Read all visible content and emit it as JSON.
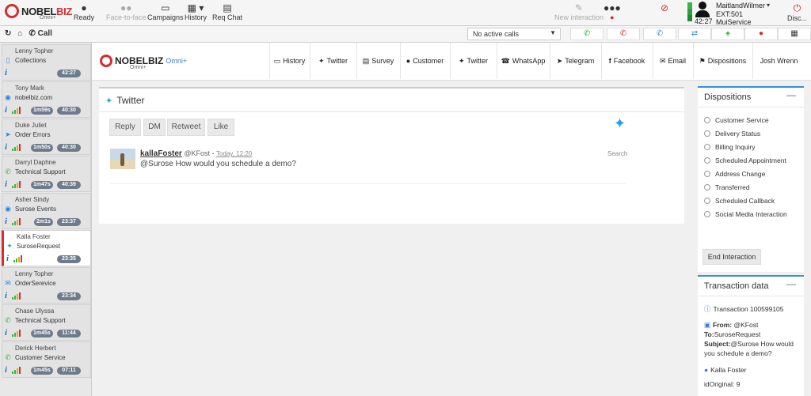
{
  "topbar": {
    "brand_main": "NOBEL",
    "brand_accent": "BIZ",
    "brand_sub": "Omni+",
    "buttons": [
      {
        "label": "Ready",
        "icon": "person-icon"
      },
      {
        "label": "Face-to-face",
        "icon": "people-icon"
      },
      {
        "label": "Campaigns",
        "icon": "folder-icon"
      },
      {
        "label": "History",
        "icon": "calendar-icon"
      },
      {
        "label": "Req Chat",
        "icon": "chat-icon"
      },
      {
        "label": "New interaction",
        "icon": "edit-icon"
      }
    ],
    "user": {
      "name": "MaitlandWilmer",
      "ext": "EXT:501",
      "service": "MuiService",
      "time": "42:27"
    },
    "disconnect_label": "Disc..."
  },
  "callbar": {
    "call_label": "Call",
    "active_calls": "No active calls"
  },
  "sidebar": {
    "conversations": [
      {
        "name": "Lenny Topher",
        "subject": "Collections",
        "channel": "phone",
        "t1": "",
        "t2": "42:27"
      },
      {
        "name": "Tony Mark",
        "subject": "nobelbiz.com",
        "channel": "chat",
        "t1": "1m59s",
        "t2": "40:30"
      },
      {
        "name": "Duke Juliet",
        "subject": "Order Errors",
        "channel": "telegram",
        "t1": "1m50s",
        "t2": "40:30"
      },
      {
        "name": "Darryl Daphne",
        "subject": "Technical Support",
        "channel": "whatsapp",
        "t1": "1m47s",
        "t2": "40:39"
      },
      {
        "name": "Asher Sindy",
        "subject": "Surose Events",
        "channel": "messenger",
        "t1": "2m1s",
        "t2": "23:37"
      },
      {
        "name": "Kalla Foster",
        "subject": "SuroseRequest",
        "channel": "twitter",
        "t1": "",
        "t2": "23:35"
      },
      {
        "name": "Lenny Topher",
        "subject": "OrderSerevice",
        "channel": "email",
        "t1": "",
        "t2": "23:34"
      },
      {
        "name": "Chase Ulyssa",
        "subject": "Technical Support",
        "channel": "whatsapp",
        "t1": "1m45s",
        "t2": "11:44"
      },
      {
        "name": "Derick Herbert",
        "subject": "Customer Service",
        "channel": "whatsapp",
        "t1": "1m45s",
        "t2": "07:11"
      }
    ]
  },
  "header": {
    "brand": "NOBELBIZ",
    "omni": "Omni+",
    "sub": "Omni+",
    "tabs": [
      "History",
      "Twitter",
      "Survey",
      "Customer",
      "Twitter",
      "WhatsApp",
      "Telegram",
      "Facebook",
      "Email",
      "Dispositions",
      "Josh Wrenn"
    ]
  },
  "twitter": {
    "title": "Twitter",
    "actions": [
      "Reply",
      "DM",
      "Retweet",
      "Like"
    ],
    "tweet": {
      "user": "kallaFoster",
      "handle": "@KFost",
      "time": "Today, 12:20",
      "text": "@Surose How would you schedule a demo?",
      "search": "Search"
    }
  },
  "dispositions": {
    "title": "Dispositions",
    "options": [
      "Customer Service",
      "Delivery Status",
      "Billing Inquiry",
      "Scheduled Appointment",
      "Address Change",
      "Transferred",
      "Scheduled Callback",
      "Social Media Interaction"
    ],
    "end_button": "End Interaction"
  },
  "transaction": {
    "title": "Transaction data",
    "id_line": "Transaction 100599105",
    "from_label": "From:",
    "from": "@KFost",
    "to_label": "To:",
    "to": "SuroseRequest",
    "subject_label": "Subject:",
    "subject": "@Surose How would you schedule a demo?",
    "contact": "Kalla Foster",
    "id_original": "idOriginal: 9"
  }
}
